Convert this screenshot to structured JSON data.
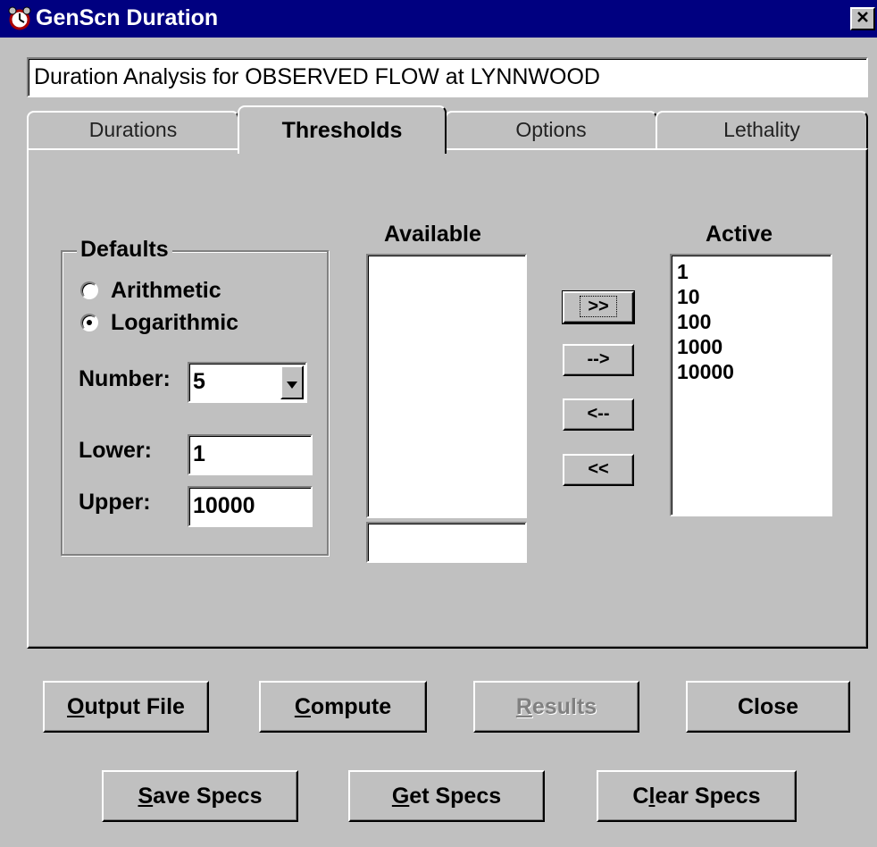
{
  "window": {
    "title": "GenScn Duration",
    "close_glyph": "×"
  },
  "analysis_title": "Duration Analysis for OBSERVED FLOW at LYNNWOOD",
  "tabs": [
    {
      "label": "Durations",
      "active": false
    },
    {
      "label": "Thresholds",
      "active": true
    },
    {
      "label": "Options",
      "active": false
    },
    {
      "label": "Lethality",
      "active": false
    }
  ],
  "defaults": {
    "legend": "Defaults",
    "radio_arithmetic": "Arithmetic",
    "radio_logarithmic": "Logarithmic",
    "selected": "Logarithmic",
    "number_label": "Number:",
    "number_value": "5",
    "lower_label": "Lower:",
    "lower_value": "1",
    "upper_label": "Upper:",
    "upper_value": "10000"
  },
  "available": {
    "header": "Available",
    "items": [],
    "input_value": ""
  },
  "active": {
    "header": "Active",
    "items": [
      "1",
      "10",
      "100",
      "1000",
      "10000"
    ]
  },
  "move_buttons": {
    "add_all": ">>",
    "add_one": "-->",
    "remove_one": "<--",
    "remove_all": "<<"
  },
  "buttons": {
    "output_file": {
      "mnemonic": "O",
      "rest": "utput File"
    },
    "compute": {
      "mnemonic": "C",
      "rest": "ompute"
    },
    "results": {
      "mnemonic": "R",
      "rest": "esults",
      "enabled": false
    },
    "close": "Close",
    "save_specs": {
      "mnemonic": "S",
      "rest": "ave Specs"
    },
    "get_specs": {
      "mnemonic": "G",
      "rest": "et Specs"
    },
    "clear_specs": {
      "pre": "C",
      "mnemonic": "l",
      "rest": "ear Specs"
    }
  },
  "colors": {
    "titlebar": "#000080",
    "face": "#c0c0c0",
    "disabled_text": "#808080"
  },
  "icons": {
    "app": "alarm-clock-icon",
    "close": "close-icon",
    "dropdown": "chevron-down-icon"
  }
}
